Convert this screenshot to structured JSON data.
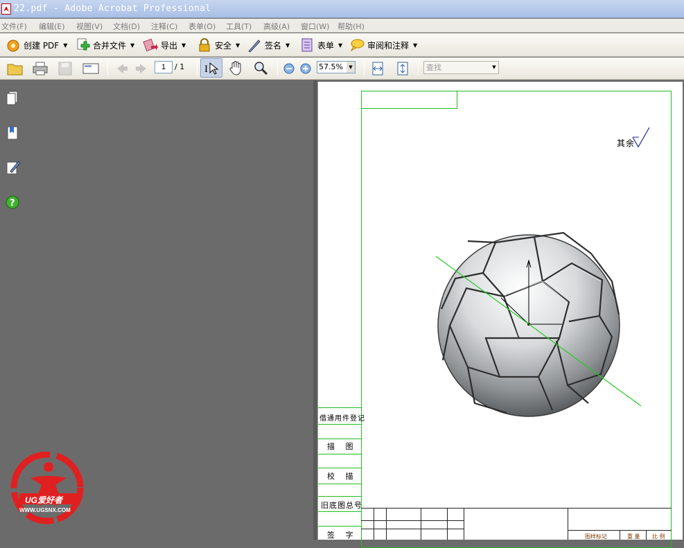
{
  "window": {
    "title": "22.pdf - Adobe Acrobat Professional"
  },
  "menu": [
    {
      "label": "文件(F)"
    },
    {
      "label": "编辑(E)"
    },
    {
      "label": "视图(V)"
    },
    {
      "label": "文档(D)"
    },
    {
      "label": "注释(C)"
    },
    {
      "label": "表单(O)"
    },
    {
      "label": "工具(T)"
    },
    {
      "label": "高级(A)"
    },
    {
      "label": "窗口(W)"
    },
    {
      "label": "帮助(H)"
    }
  ],
  "toolbar": {
    "create_pdf": "创建 PDF",
    "combine": "合并文件",
    "export": "导出",
    "security": "安全",
    "sign": "签名",
    "forms": "表单",
    "review": "审阅和注释"
  },
  "nav": {
    "page_current": "1",
    "page_total": "/ 1"
  },
  "zoom": {
    "value": "57.5%"
  },
  "find": {
    "placeholder": "查找"
  },
  "drawing": {
    "roughness_label": "其余",
    "title_block_labels": [
      "借通用件登记",
      "描 图",
      "校 描",
      "旧底图总号",
      "签 字"
    ],
    "bottom_labels": [
      "图样标记",
      "重 量",
      "比 例"
    ]
  },
  "logo": {
    "text": "UG爱好者",
    "url": "WWW.UGSNX.COM"
  },
  "colors": {
    "frame": "#22bb22",
    "logo": "#e02020",
    "title_bar": "#a9bfe6"
  }
}
